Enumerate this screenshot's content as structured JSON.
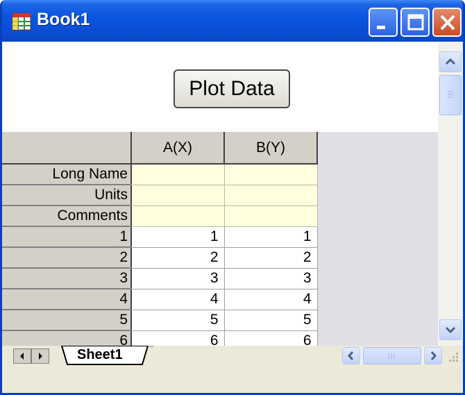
{
  "window": {
    "title": "Book1"
  },
  "toolbar": {
    "plot_label": "Plot Data"
  },
  "grid": {
    "columns": [
      "A(X)",
      "B(Y)"
    ],
    "meta_rows": [
      "Long Name",
      "Units",
      "Comments"
    ],
    "rows": [
      {
        "label": "1",
        "a": "1",
        "b": "1"
      },
      {
        "label": "2",
        "a": "2",
        "b": "2"
      },
      {
        "label": "3",
        "a": "3",
        "b": "3"
      },
      {
        "label": "4",
        "a": "4",
        "b": "4"
      },
      {
        "label": "5",
        "a": "5",
        "b": "5"
      },
      {
        "label": "6",
        "a": "6",
        "b": "6"
      }
    ]
  },
  "sheets": {
    "active": "Sheet1"
  },
  "icons": {
    "app": "worksheet-icon",
    "minimize": "minimize-icon",
    "maximize": "maximize-icon",
    "close": "close-icon"
  },
  "colors": {
    "titlebar": "#0a55e0",
    "meta_cells": "#ffffe0",
    "header": "#d4d0c8"
  }
}
